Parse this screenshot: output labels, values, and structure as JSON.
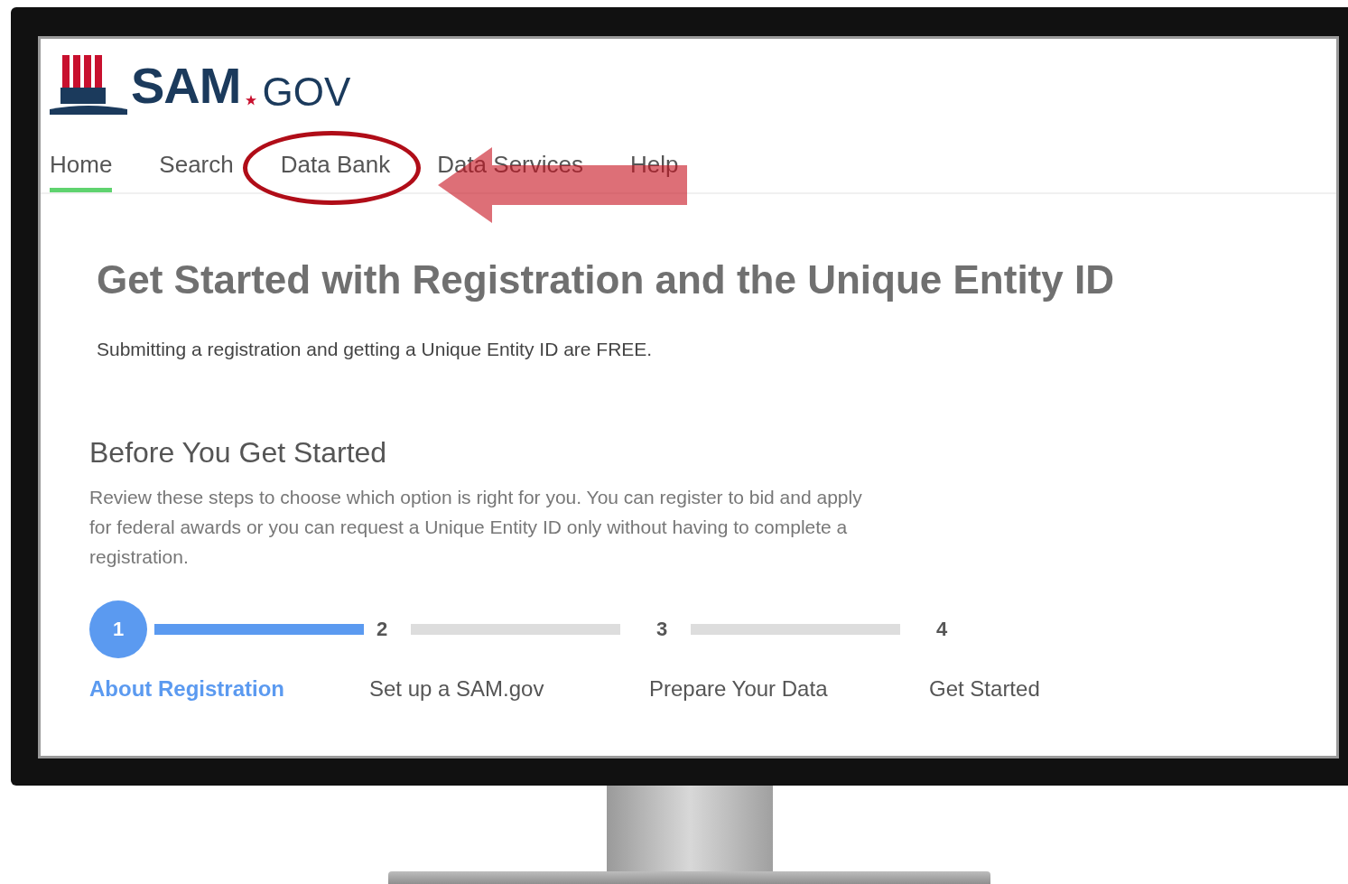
{
  "logo": {
    "name": "SAM",
    "suffix": "GOV"
  },
  "nav": [
    {
      "label": "Home",
      "selected": true,
      "circled": false
    },
    {
      "label": "Search",
      "selected": false,
      "circled": false
    },
    {
      "label": "Data Bank",
      "selected": false,
      "circled": true
    },
    {
      "label": "Data Services",
      "selected": false,
      "circled": false
    },
    {
      "label": "Help",
      "selected": false,
      "circled": false
    }
  ],
  "heading": "Get Started with Registration and the Unique Entity ID",
  "intro": "Submitting a registration and getting a Unique Entity ID are FREE.",
  "section": {
    "title": "Before You Get Started",
    "text": "Review these steps to choose which option is right for you. You can register to bid and apply for federal awards or you can request a Unique Entity ID only without having to complete a registration."
  },
  "connectors": [
    {
      "level": 1
    },
    {
      "level": 0
    },
    {
      "level": 0
    }
  ],
  "steps": [
    {
      "number": "1",
      "label": "About Registration",
      "selected": true
    },
    {
      "number": "2",
      "label": "Set up a SAM.gov",
      "selected": false
    },
    {
      "number": "3",
      "label": "Prepare Your Data",
      "selected": false
    },
    {
      "number": "4",
      "label": "Get Started",
      "selected": false
    }
  ]
}
